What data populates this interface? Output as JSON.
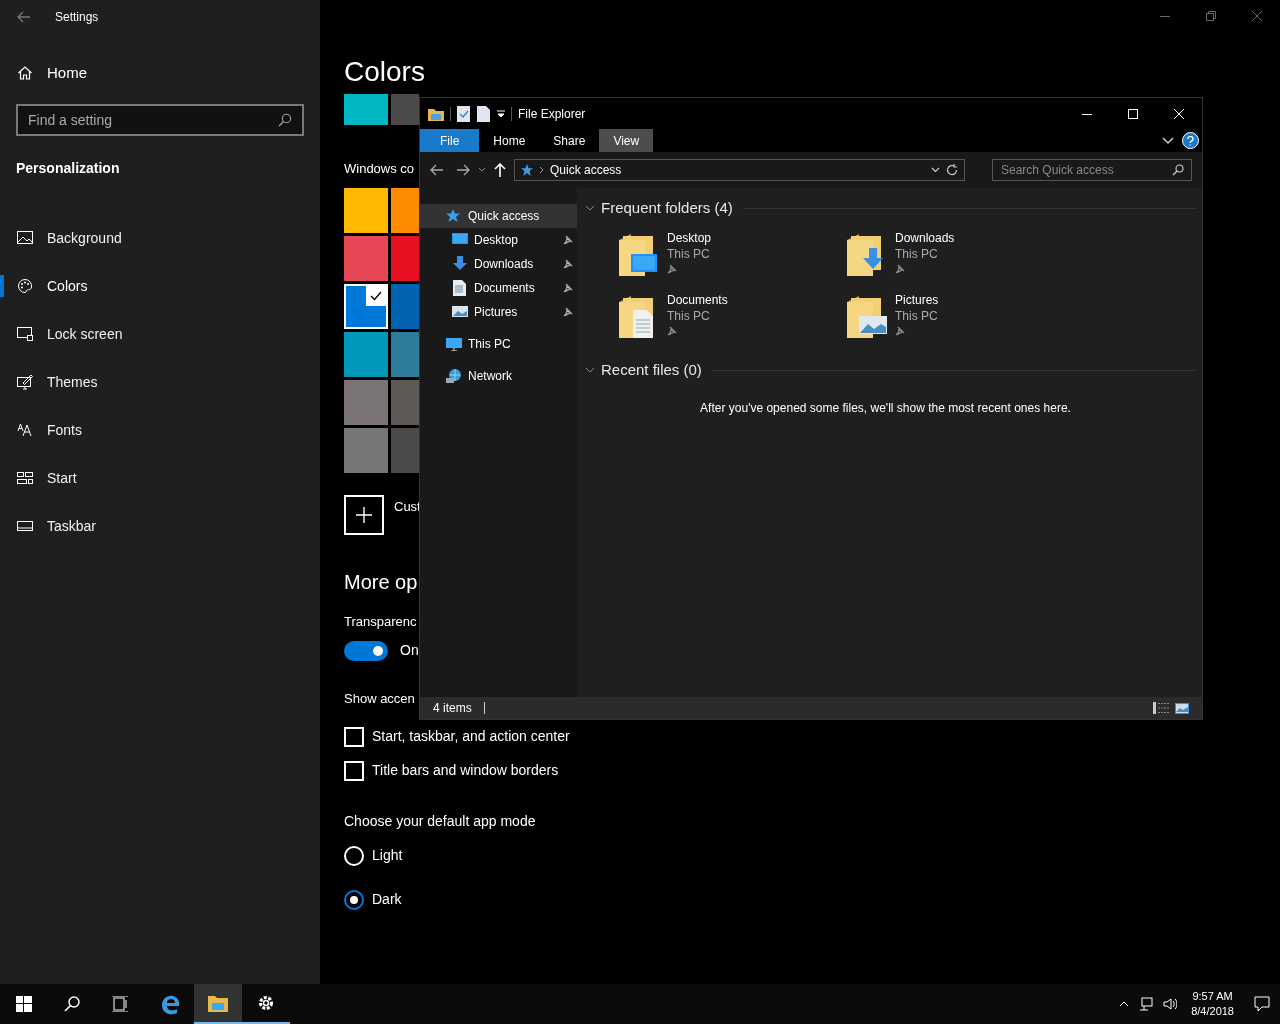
{
  "settings": {
    "title": "Settings",
    "home": "Home",
    "search": {
      "placeholder": "Find a setting"
    },
    "section": "Personalization",
    "nav": [
      {
        "label": "Background",
        "selected": false
      },
      {
        "label": "Colors",
        "selected": true
      },
      {
        "label": "Lock screen",
        "selected": false
      },
      {
        "label": "Themes",
        "selected": false
      },
      {
        "label": "Fonts",
        "selected": false
      },
      {
        "label": "Start",
        "selected": false
      },
      {
        "label": "Taskbar",
        "selected": false
      }
    ],
    "page_title": "Colors",
    "recent_colors": [
      {
        "color": "#00b7c3"
      },
      {
        "color": "#4c4a48"
      }
    ],
    "windows_colors_label": "Windows co",
    "swatches": [
      {
        "color": "#ffb900",
        "selected": false
      },
      {
        "color": "#ff8c00",
        "selected": false
      },
      {
        "color": "#e74856",
        "selected": false
      },
      {
        "color": "#e81123",
        "selected": false
      },
      {
        "color": "#0078d7",
        "selected": true
      },
      {
        "color": "#0063b1",
        "selected": false
      },
      {
        "color": "#0099bc",
        "selected": false
      },
      {
        "color": "#2d7d9a",
        "selected": false
      },
      {
        "color": "#7a7574",
        "selected": false
      },
      {
        "color": "#5d5a58",
        "selected": false
      },
      {
        "color": "#767676",
        "selected": false
      },
      {
        "color": "#4c4a48",
        "selected": false
      }
    ],
    "custom_label": "Cust",
    "more_options": "More op",
    "transparency_label": "Transparenc",
    "transparency": {
      "on": true,
      "label": "On"
    },
    "show_accent_label": "Show accen",
    "checkboxes": [
      {
        "label": "Start, taskbar, and action center",
        "checked": false
      },
      {
        "label": "Title bars and window borders",
        "checked": false
      }
    ],
    "app_mode_label": "Choose your default app mode",
    "radios": [
      {
        "label": "Light",
        "selected": false
      },
      {
        "label": "Dark",
        "selected": true
      }
    ]
  },
  "explorer": {
    "title": "File Explorer",
    "tabs": [
      {
        "label": "File",
        "kind": "menu"
      },
      {
        "label": "Home",
        "kind": "tab",
        "selected": false
      },
      {
        "label": "Share",
        "kind": "tab",
        "selected": false
      },
      {
        "label": "View",
        "kind": "tab",
        "selected": true
      }
    ],
    "address": "Quick access",
    "search": {
      "placeholder": "Search Quick access"
    },
    "tree": [
      {
        "label": "Quick access",
        "selected": true,
        "children": [
          {
            "label": "Desktop",
            "pinned": true,
            "selected": false
          },
          {
            "label": "Downloads",
            "pinned": true,
            "selected": false
          },
          {
            "label": "Documents",
            "pinned": true,
            "selected": false
          },
          {
            "label": "Pictures",
            "pinned": true,
            "selected": false
          }
        ]
      },
      {
        "label": "This PC",
        "selected": false
      },
      {
        "label": "Network",
        "selected": false
      }
    ],
    "frequent_title": "Frequent folders (4)",
    "folders": [
      {
        "name": "Desktop",
        "location": "This PC",
        "pinned": true
      },
      {
        "name": "Downloads",
        "location": "This PC",
        "pinned": true
      },
      {
        "name": "Documents",
        "location": "This PC",
        "pinned": true
      },
      {
        "name": "Pictures",
        "location": "This PC",
        "pinned": true
      }
    ],
    "recent_title": "Recent files (0)",
    "recent_empty": "After you've opened some files, we'll show the most recent ones here.",
    "status": "4 items"
  },
  "taskbar": {
    "apps": [
      {
        "active": false
      },
      {
        "active": true
      },
      {
        "active": true
      }
    ],
    "time": "9:57 AM",
    "date": "8/4/2018"
  }
}
